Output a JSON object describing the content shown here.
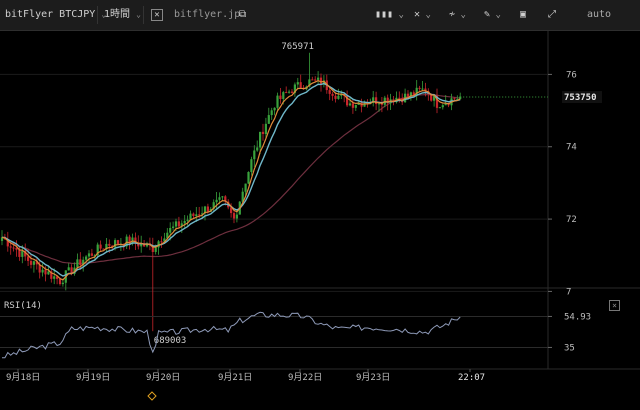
{
  "toolbar": {
    "symbol": "bitFlyer BTCJPY",
    "interval": "1時間",
    "site": "bitflyer.jp",
    "scale_mode": "auto"
  },
  "colors": {
    "up": "#39a23c",
    "down": "#c9262c",
    "ema_fast": "#e08a3a",
    "ema_mid": "#6fb7c9",
    "sma_slow": "#6e2f3e",
    "rsi": "#8e9ab8",
    "price_tag_bg": "#111",
    "grid": "#1b1b1b"
  },
  "chart_data": {
    "type": "candlestick",
    "price_ylim": [
      701500,
      772000
    ],
    "y_ticks": [
      {
        "value": 760000,
        "label": "76"
      },
      {
        "value": 740000,
        "label": "74"
      },
      {
        "value": 720000,
        "label": "72"
      },
      {
        "value": 700000,
        "label": "7"
      }
    ],
    "x_ticks": [
      "9月18日",
      "9月19日",
      "9月20日",
      "9月21日",
      "9月22日",
      "9月23日",
      "22:07"
    ],
    "last_price": {
      "value": 753750,
      "label": "753750"
    },
    "high_marker": {
      "value": 765971,
      "label": "765971"
    },
    "low_marker": {
      "value": 689003,
      "label": "689003"
    },
    "price_anchors": [
      [
        0,
        715000
      ],
      [
        10,
        708000
      ],
      [
        20,
        703000
      ],
      [
        28,
        709000
      ],
      [
        36,
        713000
      ],
      [
        44,
        714000
      ],
      [
        52,
        712000
      ],
      [
        56,
        716000
      ],
      [
        60,
        718000
      ],
      [
        68,
        722000
      ],
      [
        76,
        725000
      ],
      [
        80,
        720000
      ],
      [
        86,
        736000
      ],
      [
        90,
        745000
      ],
      [
        94,
        752000
      ],
      [
        100,
        756000
      ],
      [
        106,
        758000
      ],
      [
        110,
        758000
      ],
      [
        116,
        754000
      ],
      [
        120,
        752000
      ],
      [
        130,
        753000
      ],
      [
        140,
        754000
      ],
      [
        146,
        756000
      ],
      [
        150,
        752000
      ],
      [
        158,
        753750
      ]
    ],
    "rsi": {
      "title": "RSI(14)",
      "ylim": [
        25,
        70
      ],
      "levels": [
        {
          "value": 54.93,
          "label": "54.93"
        },
        {
          "value": 35,
          "label": "35"
        }
      ],
      "anchors": [
        [
          0,
          29
        ],
        [
          10,
          34
        ],
        [
          20,
          38
        ],
        [
          24,
          47
        ],
        [
          32,
          48
        ],
        [
          44,
          46
        ],
        [
          50,
          45
        ],
        [
          52,
          32
        ],
        [
          54,
          44
        ],
        [
          60,
          45
        ],
        [
          70,
          47
        ],
        [
          78,
          46
        ],
        [
          82,
          52
        ],
        [
          88,
          56
        ],
        [
          96,
          56
        ],
        [
          104,
          55
        ],
        [
          110,
          50
        ],
        [
          116,
          47
        ],
        [
          126,
          48
        ],
        [
          136,
          47
        ],
        [
          146,
          45
        ],
        [
          152,
          49
        ],
        [
          158,
          54.93
        ]
      ]
    }
  }
}
